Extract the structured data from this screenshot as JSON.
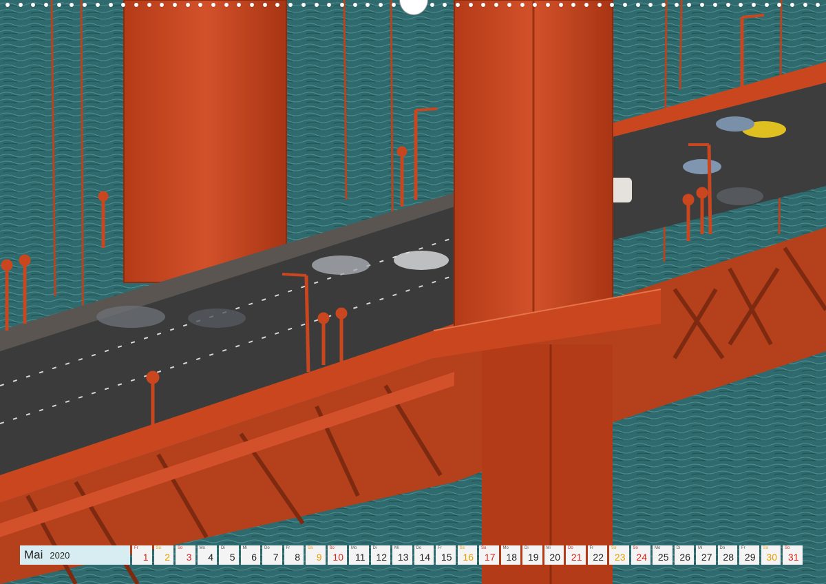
{
  "calendar": {
    "month": "Mai",
    "year": "2020",
    "days": [
      {
        "wd": "Fr",
        "d": "1",
        "type": "sun"
      },
      {
        "wd": "Sa",
        "d": "2",
        "type": "sat"
      },
      {
        "wd": "So",
        "d": "3",
        "type": "sun"
      },
      {
        "wd": "Mo",
        "d": "4",
        "type": "wk"
      },
      {
        "wd": "Di",
        "d": "5",
        "type": "wk"
      },
      {
        "wd": "Mi",
        "d": "6",
        "type": "wk"
      },
      {
        "wd": "Do",
        "d": "7",
        "type": "wk"
      },
      {
        "wd": "Fr",
        "d": "8",
        "type": "wk"
      },
      {
        "wd": "Sa",
        "d": "9",
        "type": "sat"
      },
      {
        "wd": "So",
        "d": "10",
        "type": "sun"
      },
      {
        "wd": "Mo",
        "d": "11",
        "type": "wk"
      },
      {
        "wd": "Di",
        "d": "12",
        "type": "wk"
      },
      {
        "wd": "Mi",
        "d": "13",
        "type": "wk"
      },
      {
        "wd": "Do",
        "d": "14",
        "type": "wk"
      },
      {
        "wd": "Fr",
        "d": "15",
        "type": "wk"
      },
      {
        "wd": "Sa",
        "d": "16",
        "type": "sat"
      },
      {
        "wd": "So",
        "d": "17",
        "type": "sun"
      },
      {
        "wd": "Mo",
        "d": "18",
        "type": "wk"
      },
      {
        "wd": "Di",
        "d": "19",
        "type": "wk"
      },
      {
        "wd": "Mi",
        "d": "20",
        "type": "wk"
      },
      {
        "wd": "Do",
        "d": "21",
        "type": "sun"
      },
      {
        "wd": "Fr",
        "d": "22",
        "type": "wk"
      },
      {
        "wd": "Sa",
        "d": "23",
        "type": "sat"
      },
      {
        "wd": "So",
        "d": "24",
        "type": "sun"
      },
      {
        "wd": "Mo",
        "d": "25",
        "type": "wk"
      },
      {
        "wd": "Di",
        "d": "26",
        "type": "wk"
      },
      {
        "wd": "Mi",
        "d": "27",
        "type": "wk"
      },
      {
        "wd": "Do",
        "d": "28",
        "type": "wk"
      },
      {
        "wd": "Fr",
        "d": "29",
        "type": "wk"
      },
      {
        "wd": "Sa",
        "d": "30",
        "type": "sat"
      },
      {
        "wd": "So",
        "d": "31",
        "type": "sun"
      }
    ]
  },
  "colors": {
    "water": "#2f6b6e",
    "bridge": "#c9461f",
    "road": "#3b3b3b",
    "saturday": "#e8a000",
    "holiday": "#d6281c"
  }
}
